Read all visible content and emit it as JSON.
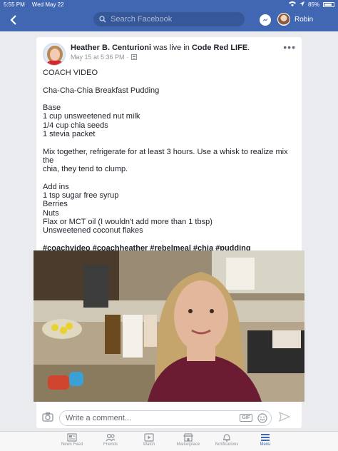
{
  "status_bar": {
    "time": "5:55 PM",
    "date": "Wed May 22",
    "battery": "85%",
    "battery_level": 0.85
  },
  "nav": {
    "search_placeholder": "Search Facebook",
    "user_name": "Robin"
  },
  "post": {
    "author": "Heather B. Centurioni",
    "action": " was live in ",
    "group": "Code Red LIFE",
    "period": ".",
    "date": "May 15 at 5:36 PM",
    "date_sep": "·",
    "lines": [
      "COACH VIDEO",
      "",
      "Cha-Cha-Chia Breakfast Pudding",
      "",
      "Base",
      "1 cup unsweetened nut milk",
      "1/4 cup chia seeds",
      "1 stevia packet",
      "",
      "Mix together, refrigerate for at least 3 hours. Use a whisk to realize mix the",
      "chia, they tend to clump.",
      "",
      "Add ins",
      "1 tsp sugar free syrup",
      "Berries",
      "Nuts",
      "Flax or MCT oil (I wouldn't add more than 1 tbsp)",
      "Unsweetened coconut flakes",
      ""
    ],
    "hashtags": "#coachvideo #coachheather #rebelmeal #chia #pudding"
  },
  "comment": {
    "placeholder": "Write a comment...",
    "gif_label": "GIF"
  },
  "tabs": [
    {
      "label": "News Feed",
      "icon": "news-feed-icon"
    },
    {
      "label": "Friends",
      "icon": "friends-icon"
    },
    {
      "label": "Watch",
      "icon": "watch-icon"
    },
    {
      "label": "Marketplace",
      "icon": "marketplace-icon"
    },
    {
      "label": "Notifications",
      "icon": "notifications-icon"
    },
    {
      "label": "Menu",
      "icon": "menu-icon"
    }
  ],
  "colors": {
    "brand": "#4267b2",
    "active_tab": "#4267b2"
  }
}
